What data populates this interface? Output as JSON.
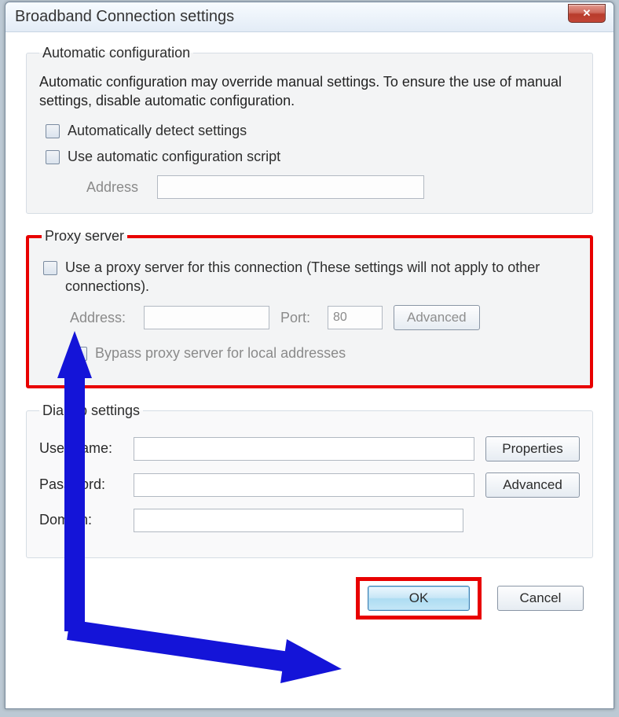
{
  "window": {
    "title": "Broadband Connection settings"
  },
  "autoConfig": {
    "legend": "Automatic configuration",
    "desc": "Automatic configuration may override manual settings.  To ensure the use of manual settings, disable automatic configuration.",
    "cbDetect": "Automatically detect settings",
    "cbScript": "Use automatic configuration script",
    "addressLabel": "Address"
  },
  "proxy": {
    "legend": "Proxy server",
    "cbUseProxy": "Use a proxy server for this connection (These settings will not apply to other connections).",
    "addressLabel": "Address:",
    "portLabel": "Port:",
    "portValue": "80",
    "advanced": "Advanced",
    "cbBypass": "Bypass proxy server for local addresses"
  },
  "dialup": {
    "legend": "Dial-up settings",
    "userLabel": "User name:",
    "passLabel": "Password:",
    "domainLabel": "Domain:",
    "properties": "Properties",
    "advanced": "Advanced"
  },
  "footer": {
    "ok": "OK",
    "cancel": "Cancel"
  }
}
